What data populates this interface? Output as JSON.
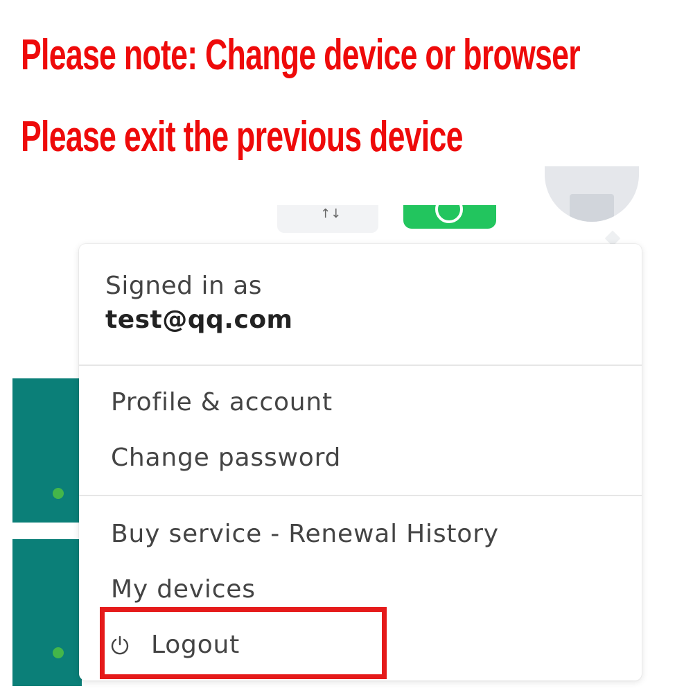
{
  "notice": {
    "line1": "Please note: Change device or browser",
    "line2": "Please exit the previous device"
  },
  "topbar": {
    "grey_button_glyph": "↑↓",
    "icons": [
      "action-icon",
      "whatsapp-icon",
      "avatar-icon"
    ]
  },
  "dropdown": {
    "signed_in_label": "Signed in as",
    "email": "test@qq.com",
    "items": [
      {
        "label": "Profile & account"
      },
      {
        "label": "Change password"
      },
      {
        "label": "Buy service - Renewal History"
      },
      {
        "label": "My devices"
      },
      {
        "label": "Logout",
        "icon": "power-icon"
      }
    ]
  },
  "colors": {
    "notice_red": "#ee0a0a",
    "highlight_red": "#e51a1a",
    "teal": "#0b7f78",
    "status_green": "#44b64a",
    "whatsapp_green": "#22c55e"
  }
}
